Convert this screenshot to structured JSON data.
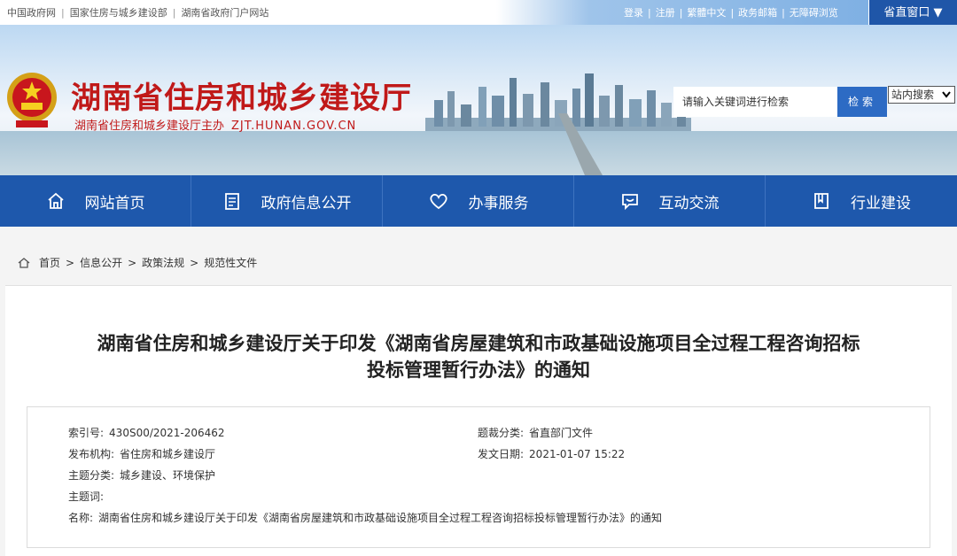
{
  "topbar": {
    "links_left": [
      "中国政府网",
      "国家住房与城乡建设部",
      "湖南省政府门户网站"
    ],
    "links_right": [
      "登录",
      "注册",
      "繁體中文",
      "政务邮箱",
      "无障碍浏览"
    ],
    "dept_button": "省直窗口 ▼"
  },
  "header": {
    "title": "湖南省住房和城乡建设厅",
    "subtitle": "湖南省住房和城乡建设厅主办",
    "url": "ZJT.HUNAN.GOV.CN",
    "search_placeholder": "请输入关键词进行检索",
    "search_button": "检索",
    "search_scope": "站内搜索"
  },
  "nav": {
    "items": [
      {
        "label": "网站首页",
        "icon": "home-icon"
      },
      {
        "label": "政府信息公开",
        "icon": "document-icon"
      },
      {
        "label": "办事服务",
        "icon": "heart-icon"
      },
      {
        "label": "互动交流",
        "icon": "chat-icon"
      },
      {
        "label": "行业建设",
        "icon": "book-icon"
      }
    ]
  },
  "breadcrumb": [
    "首页",
    "信息公开",
    "政策法规",
    "规范性文件"
  ],
  "document": {
    "title_line1": "湖南省住房和城乡建设厅关于印发《湖南省房屋建筑和市政基础设施项目全过程工程咨询招标",
    "title_line2": "投标管理暂行办法》的通知",
    "index_no_label": "索引号:",
    "index_no": "430S00/2021-206462",
    "category_label": "题裁分类:",
    "category": "省直部门文件",
    "issuer_label": "发布机构:",
    "issuer": "省住房和城乡建设厅",
    "date_label": "发文日期:",
    "date": "2021-01-07 15:22",
    "topic_label": "主题分类:",
    "topic": "城乡建设、环境保护",
    "keywords_label": "主题词:",
    "keywords": "",
    "name_label": "名称:",
    "name": "湖南省住房和城乡建设厅关于印发《湖南省房屋建筑和市政基础设施项目全过程工程咨询招标投标管理暂行办法》的通知"
  },
  "colors": {
    "nav_bg": "#1e58ac",
    "title_red": "#c01919",
    "search_btn": "#2d6bc4"
  }
}
